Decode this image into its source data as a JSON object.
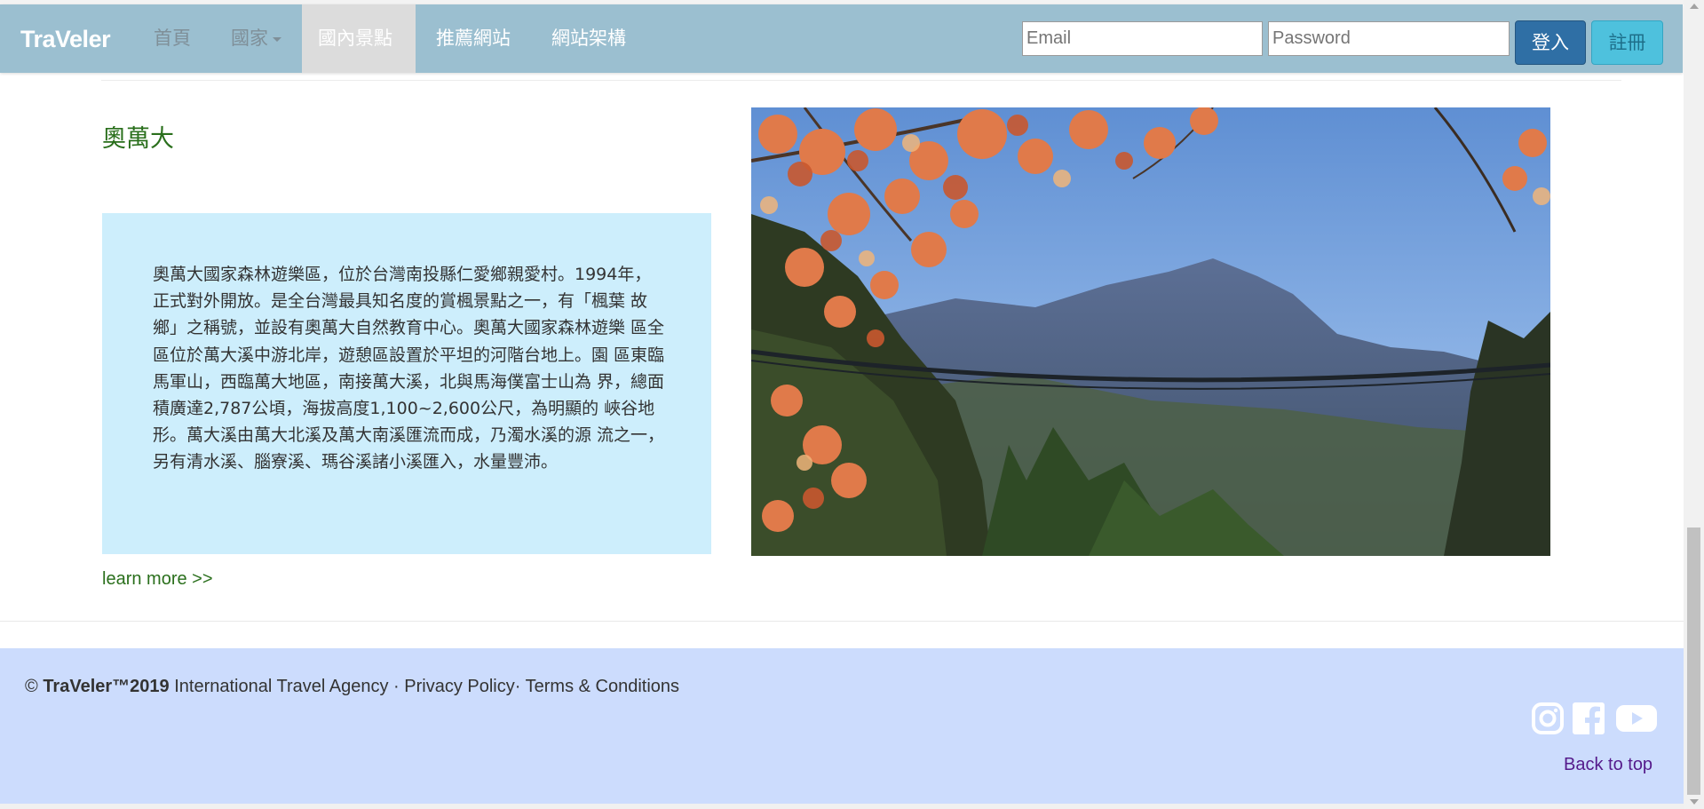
{
  "navbar": {
    "brand": "TraVeler",
    "items": [
      {
        "label": "首頁"
      },
      {
        "label": "國家"
      },
      {
        "label": "國內景點"
      },
      {
        "label": "推薦網站"
      },
      {
        "label": "網站架構"
      }
    ],
    "email_placeholder": "Email",
    "password_placeholder": "Password",
    "login_label": "登入",
    "register_label": "註冊"
  },
  "main": {
    "title": "奧萬大",
    "description": "奧萬大國家森林遊樂區，位於台灣南投縣仁愛鄉親愛村。1994年， 正式對外開放。是全台灣最具知名度的賞楓景點之一，有「楓葉 故鄉」之稱號，並設有奧萬大自然教育中心。奧萬大國家森林遊樂 區全區位於萬大溪中游北岸，遊憩區設置於平坦的河階台地上。園 區東臨馬軍山，西臨萬大地區，南接萬大溪，北與馬海僕富士山為 界，總面積廣達2,787公頃，海拔高度1,100~2,600公尺，為明顯的 峽谷地形。萬大溪由萬大北溪及萬大南溪匯流而成，乃濁水溪的源 流之一，另有清水溪、腦寮溪、瑪谷溪諸小溪匯入，水量豐沛。",
    "learn_more": "learn more >>"
  },
  "footer": {
    "copyright_symbol": "©",
    "brand": "TraVeler™2019",
    "agency": "International Travel Agency",
    "sep1": "·",
    "privacy": "Privacy Policy",
    "sep2": "·",
    "terms": "Terms & Conditions",
    "back_to_top": "Back to top"
  },
  "colors": {
    "navbar": "#9bbfd0",
    "heading_green": "#2a6f1c",
    "desc_bg": "#cdeefc",
    "footer_bg": "#ccdcfd",
    "login_btn": "#2f6fa5",
    "register_btn": "#4ec1dd"
  }
}
